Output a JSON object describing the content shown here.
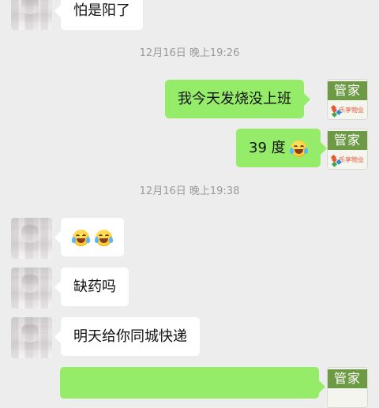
{
  "messages": [
    {
      "text": "怕是阳了"
    },
    {
      "time": "12月16日 晚上19:26"
    },
    {
      "text": "我今天发烧没上班",
      "avatar_title": "管家",
      "avatar_brand": "乐享物业"
    },
    {
      "text": "39 度",
      "emoji": "crying-laughing-emoji",
      "avatar_title": "管家",
      "avatar_brand": "乐享物业"
    },
    {
      "time": "12月16日 晚上19:38"
    },
    {
      "emoji": "crying-laughing-emoji"
    },
    {
      "text": "缺药吗"
    },
    {
      "text": "明天给你同城快递"
    },
    {
      "avatar_title": "管家"
    }
  ],
  "colors": {
    "background": "#ededed",
    "incoming_bubble": "#ffffff",
    "outgoing_bubble": "#95ec69",
    "timestamp": "#9a9a9a",
    "manager_accent": "#6d9a45"
  }
}
